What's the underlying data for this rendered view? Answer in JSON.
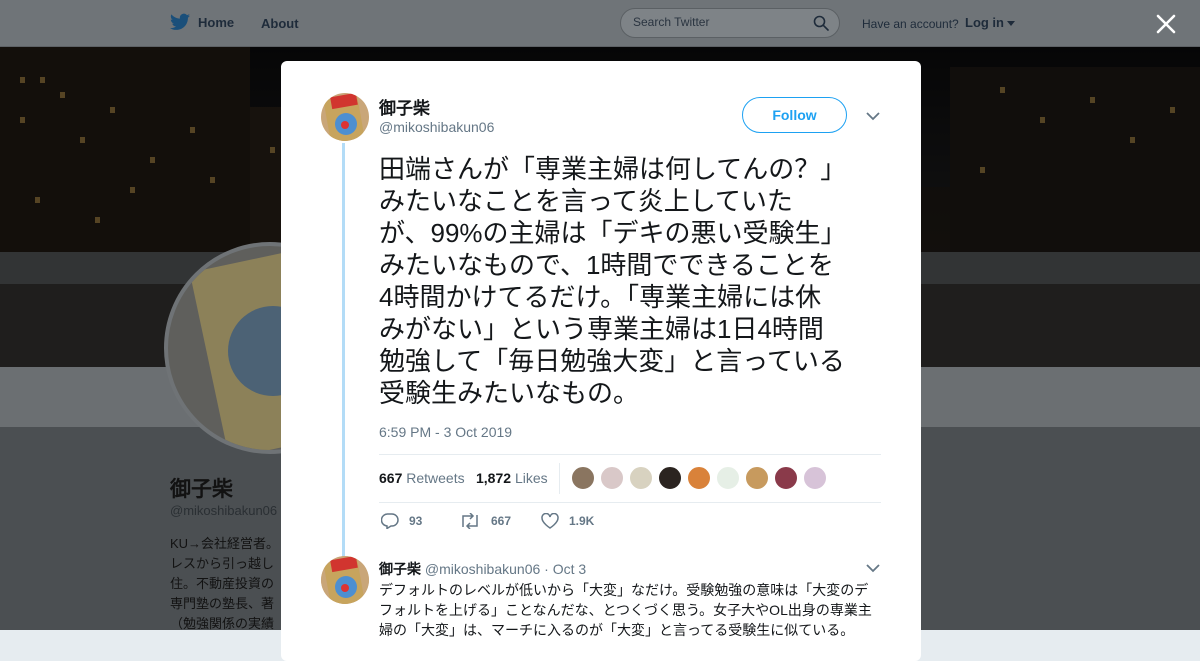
{
  "topbar": {
    "home_label": "Home",
    "about_label": "About",
    "search_placeholder": "Search Twitter",
    "have_account": "Have an account?",
    "login_label": "Log in"
  },
  "profile": {
    "name": "御子柴",
    "handle": "@mikoshibakun06",
    "bio_lines": [
      "KU→会社経営者。",
      "レスから引っ越し",
      "住。不動産投資の",
      "専門塾の塾長、著",
      "（勉強関係の実績"
    ]
  },
  "tweet": {
    "author_name": "御子柴",
    "author_handle": "@mikoshibakun06",
    "follow_label": "Follow",
    "text": "田端さんが「専業主婦は何してんの？」\nみたいなことを言って炎上していた\nが、99%の主婦は「デキの悪い受験生」\nみたいなもので、1時間でできることを\n4時間かけてるだけ。「専業主婦には休\nみがない」という専業主婦は1日4時間\n勉強して「毎日勉強大変」と言っている\n受験生みたいなもの。",
    "timestamp": "6:59 PM - 3 Oct 2019",
    "retweets_count": "667",
    "retweets_label": "Retweets",
    "likes_count": "1,872",
    "likes_label": "Likes",
    "liker_colors": [
      "#8a7560",
      "#d9c8c8",
      "#d8d2c0",
      "#2b2420",
      "#d9823a",
      "#e6efe6",
      "#c79a5e",
      "#8a3a4a",
      "#d7c3d8"
    ],
    "actions": {
      "replies": "93",
      "retweets": "667",
      "likes": "1.9K"
    }
  },
  "reply": {
    "name": "御子柴",
    "handle": "@mikoshibakun06",
    "sep": "·",
    "date": "Oct 3",
    "text": "デフォルトのレベルが低いから「大変」なだけ。受験勉強の意味は「大変のデ\nフォルトを上げる」ことなんだな、とつくづく思う。女子大やOL出身の専業主\n婦の「大変」は、マーチに入るのが「大変」と言ってる受験生に似ている。"
  },
  "colors": {
    "accent": "#1da1f2",
    "thread_line": "#b3dcf7"
  }
}
